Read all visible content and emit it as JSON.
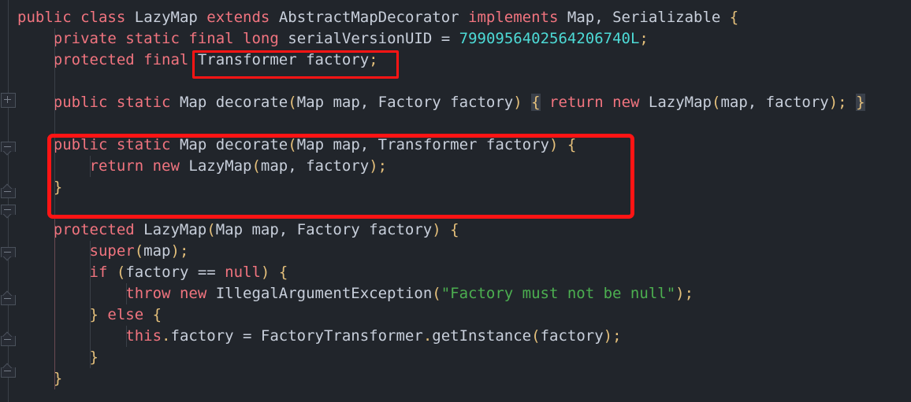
{
  "editor": {
    "theme_background": "#21252b",
    "keyword_color": "#f1747f",
    "identifier_color": "#c8cfdb",
    "number_color": "#4ddad6",
    "string_color": "#4caf50",
    "brace_color": "#e5c07b",
    "annotation_color": "#ff1414"
  },
  "gutter": {
    "markers": [
      {
        "name": "fold-expand-class",
        "glyph": "+",
        "type": "plus"
      },
      {
        "name": "fold-end-marker-1",
        "glyph": "-",
        "type": "down"
      },
      {
        "name": "fold-start-marker-1",
        "glyph": "-",
        "type": "up"
      },
      {
        "name": "fold-end-marker-2",
        "glyph": "-",
        "type": "down"
      },
      {
        "name": "fold-end-marker-3",
        "glyph": "-",
        "type": "down"
      },
      {
        "name": "fold-start-marker-2",
        "glyph": "-",
        "type": "up"
      },
      {
        "name": "fold-start-marker-3",
        "glyph": "-",
        "type": "up"
      },
      {
        "name": "fold-start-marker-4",
        "glyph": "-",
        "type": "up"
      }
    ]
  },
  "code": {
    "language": "java",
    "lines": [
      {
        "n": 1,
        "indent": 0,
        "text": "public class LazyMap extends AbstractMapDecorator implements Map, Serializable {",
        "tokens": [
          {
            "t": "public",
            "c": "kw"
          },
          {
            "t": " ",
            "c": "pn"
          },
          {
            "t": "class",
            "c": "kw"
          },
          {
            "t": " ",
            "c": "pn"
          },
          {
            "t": "LazyMap",
            "c": "id"
          },
          {
            "t": " ",
            "c": "pn"
          },
          {
            "t": "extends",
            "c": "kw"
          },
          {
            "t": " ",
            "c": "pn"
          },
          {
            "t": "AbstractMapDecorator",
            "c": "id"
          },
          {
            "t": " ",
            "c": "pn"
          },
          {
            "t": "implements",
            "c": "kw"
          },
          {
            "t": " ",
            "c": "pn"
          },
          {
            "t": "Map, Serializable ",
            "c": "id"
          },
          {
            "t": "{",
            "c": "br"
          }
        ]
      },
      {
        "n": 2,
        "indent": 1,
        "text": "    private static final long serialVersionUID = 7990956402564206740L;",
        "tokens": [
          {
            "t": "    ",
            "c": "pn"
          },
          {
            "t": "private",
            "c": "kw"
          },
          {
            "t": " ",
            "c": "pn"
          },
          {
            "t": "static",
            "c": "kw"
          },
          {
            "t": " ",
            "c": "pn"
          },
          {
            "t": "final",
            "c": "kw"
          },
          {
            "t": " ",
            "c": "pn"
          },
          {
            "t": "long",
            "c": "kw"
          },
          {
            "t": " ",
            "c": "pn"
          },
          {
            "t": "serialVersionUID ",
            "c": "id"
          },
          {
            "t": "= ",
            "c": "op"
          },
          {
            "t": "7990956402564206740L",
            "c": "num"
          },
          {
            "t": ";",
            "c": "br"
          }
        ]
      },
      {
        "n": 3,
        "indent": 1,
        "text": "    protected final Transformer factory;",
        "tokens": [
          {
            "t": "    ",
            "c": "pn"
          },
          {
            "t": "protected",
            "c": "kw"
          },
          {
            "t": " ",
            "c": "pn"
          },
          {
            "t": "final",
            "c": "kw"
          },
          {
            "t": " ",
            "c": "pn"
          },
          {
            "t": "Transformer factory",
            "c": "id"
          },
          {
            "t": ";",
            "c": "br"
          }
        ]
      },
      {
        "n": 4,
        "indent": 1,
        "text": "",
        "tokens": []
      },
      {
        "n": 5,
        "indent": 1,
        "text": "    public static Map decorate(Map map, Factory factory) { return new LazyMap(map, factory); }",
        "tokens": [
          {
            "t": "    ",
            "c": "pn"
          },
          {
            "t": "public",
            "c": "kw"
          },
          {
            "t": " ",
            "c": "pn"
          },
          {
            "t": "static",
            "c": "kw"
          },
          {
            "t": " ",
            "c": "pn"
          },
          {
            "t": "Map decorate",
            "c": "id"
          },
          {
            "t": "(",
            "c": "br"
          },
          {
            "t": "Map map, Factory factory",
            "c": "id"
          },
          {
            "t": ")",
            "c": "br"
          },
          {
            "t": " ",
            "c": "pn"
          },
          {
            "t": "{",
            "c": "br match"
          },
          {
            "t": " ",
            "c": "pn"
          },
          {
            "t": "return",
            "c": "kw"
          },
          {
            "t": " ",
            "c": "pn"
          },
          {
            "t": "new",
            "c": "kw"
          },
          {
            "t": " ",
            "c": "pn"
          },
          {
            "t": "LazyMap",
            "c": "id"
          },
          {
            "t": "(",
            "c": "br"
          },
          {
            "t": "map, factory",
            "c": "id"
          },
          {
            "t": ");",
            "c": "br"
          },
          {
            "t": " ",
            "c": "pn"
          },
          {
            "t": "}",
            "c": "br match"
          }
        ]
      },
      {
        "n": 6,
        "indent": 1,
        "text": "",
        "tokens": []
      },
      {
        "n": 7,
        "indent": 1,
        "text": "    public static Map decorate(Map map, Transformer factory) {",
        "tokens": [
          {
            "t": "    ",
            "c": "pn"
          },
          {
            "t": "public",
            "c": "kw"
          },
          {
            "t": " ",
            "c": "pn"
          },
          {
            "t": "static",
            "c": "kw"
          },
          {
            "t": " ",
            "c": "pn"
          },
          {
            "t": "Map decorate",
            "c": "id"
          },
          {
            "t": "(",
            "c": "br"
          },
          {
            "t": "Map map, Transformer factory",
            "c": "id"
          },
          {
            "t": ")",
            "c": "br"
          },
          {
            "t": " ",
            "c": "pn"
          },
          {
            "t": "{",
            "c": "br"
          }
        ]
      },
      {
        "n": 8,
        "indent": 2,
        "text": "        return new LazyMap(map, factory);",
        "tokens": [
          {
            "t": "        ",
            "c": "pn"
          },
          {
            "t": "return",
            "c": "kw"
          },
          {
            "t": " ",
            "c": "pn"
          },
          {
            "t": "new",
            "c": "kw"
          },
          {
            "t": " ",
            "c": "pn"
          },
          {
            "t": "LazyMap",
            "c": "id"
          },
          {
            "t": "(",
            "c": "br"
          },
          {
            "t": "map, factory",
            "c": "id"
          },
          {
            "t": ");",
            "c": "br"
          }
        ]
      },
      {
        "n": 9,
        "indent": 1,
        "text": "    }",
        "tokens": [
          {
            "t": "    ",
            "c": "pn"
          },
          {
            "t": "}",
            "c": "br"
          }
        ]
      },
      {
        "n": 10,
        "indent": 1,
        "text": "",
        "tokens": []
      },
      {
        "n": 11,
        "indent": 1,
        "text": "    protected LazyMap(Map map, Factory factory) {",
        "tokens": [
          {
            "t": "    ",
            "c": "pn"
          },
          {
            "t": "protected",
            "c": "kw"
          },
          {
            "t": " ",
            "c": "pn"
          },
          {
            "t": "LazyMap",
            "c": "id"
          },
          {
            "t": "(",
            "c": "br"
          },
          {
            "t": "Map map, Factory factory",
            "c": "id"
          },
          {
            "t": ")",
            "c": "br"
          },
          {
            "t": " ",
            "c": "pn"
          },
          {
            "t": "{",
            "c": "br"
          }
        ]
      },
      {
        "n": 12,
        "indent": 2,
        "text": "        super(map);",
        "tokens": [
          {
            "t": "        ",
            "c": "pn"
          },
          {
            "t": "super",
            "c": "kw"
          },
          {
            "t": "(",
            "c": "br"
          },
          {
            "t": "map",
            "c": "id"
          },
          {
            "t": ");",
            "c": "br"
          }
        ]
      },
      {
        "n": 13,
        "indent": 2,
        "text": "        if (factory == null) {",
        "tokens": [
          {
            "t": "        ",
            "c": "pn"
          },
          {
            "t": "if",
            "c": "kw"
          },
          {
            "t": " ",
            "c": "pn"
          },
          {
            "t": "(",
            "c": "br"
          },
          {
            "t": "factory ",
            "c": "id"
          },
          {
            "t": "== ",
            "c": "op"
          },
          {
            "t": "null",
            "c": "kw"
          },
          {
            "t": ")",
            "c": "br"
          },
          {
            "t": " ",
            "c": "pn"
          },
          {
            "t": "{",
            "c": "br"
          }
        ]
      },
      {
        "n": 14,
        "indent": 3,
        "text": "            throw new IllegalArgumentException(\"Factory must not be null\");",
        "tokens": [
          {
            "t": "            ",
            "c": "pn"
          },
          {
            "t": "throw",
            "c": "kw"
          },
          {
            "t": " ",
            "c": "pn"
          },
          {
            "t": "new",
            "c": "kw"
          },
          {
            "t": " ",
            "c": "pn"
          },
          {
            "t": "IllegalArgumentException",
            "c": "id"
          },
          {
            "t": "(",
            "c": "br"
          },
          {
            "t": "\"Factory must not be null\"",
            "c": "str"
          },
          {
            "t": ");",
            "c": "br"
          }
        ]
      },
      {
        "n": 15,
        "indent": 2,
        "text": "        } else {",
        "tokens": [
          {
            "t": "        ",
            "c": "pn"
          },
          {
            "t": "}",
            "c": "br"
          },
          {
            "t": " ",
            "c": "pn"
          },
          {
            "t": "else",
            "c": "kw"
          },
          {
            "t": " ",
            "c": "pn"
          },
          {
            "t": "{",
            "c": "br"
          }
        ]
      },
      {
        "n": 16,
        "indent": 3,
        "text": "            this.factory = FactoryTransformer.getInstance(factory);",
        "tokens": [
          {
            "t": "            ",
            "c": "pn"
          },
          {
            "t": "this",
            "c": "kw"
          },
          {
            "t": ".",
            "c": "br"
          },
          {
            "t": "factory ",
            "c": "id"
          },
          {
            "t": "= ",
            "c": "op"
          },
          {
            "t": "FactoryTransformer",
            "c": "id"
          },
          {
            "t": ".",
            "c": "br"
          },
          {
            "t": "getInstance",
            "c": "id"
          },
          {
            "t": "(",
            "c": "br"
          },
          {
            "t": "factory",
            "c": "id"
          },
          {
            "t": ");",
            "c": "br"
          }
        ]
      },
      {
        "n": 17,
        "indent": 2,
        "text": "        }",
        "tokens": [
          {
            "t": "        ",
            "c": "pn"
          },
          {
            "t": "}",
            "c": "br"
          }
        ]
      },
      {
        "n": 18,
        "indent": 1,
        "text": "    }",
        "tokens": [
          {
            "t": "    ",
            "c": "pn"
          },
          {
            "t": "}",
            "c": "br"
          }
        ]
      }
    ]
  },
  "annotations": [
    {
      "name": "highlight-box-transformer-factory",
      "label": "Transformer factory;",
      "style": "thin"
    },
    {
      "name": "highlight-box-decorate-transformer-overload",
      "label": "public static Map decorate(Map map, Transformer factory) { return new LazyMap(map, factory); }",
      "style": "thick"
    }
  ]
}
